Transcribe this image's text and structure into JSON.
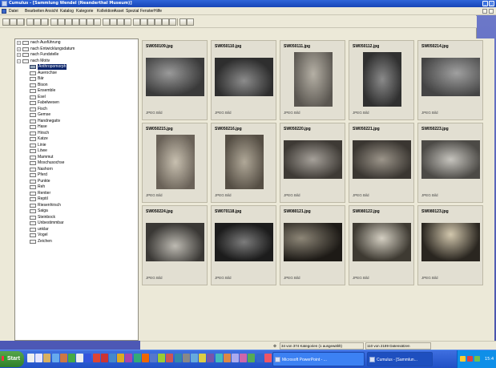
{
  "window": {
    "title": "Cumulus - [Sammlung Wendel (Neanderthal Museum)]"
  },
  "menu": [
    "Datei",
    "Bearbeiten",
    "Ansicht",
    "Katalog",
    "Kategorie",
    "Kollektion",
    "Asset",
    "Spezial",
    "Fenster",
    "Hilfe"
  ],
  "tree": {
    "roots": [
      {
        "label": "nach Ausführung",
        "expander": "+"
      },
      {
        "label": "nach Entwicklungsdatum",
        "expander": "+"
      },
      {
        "label": "nach Fundstelle",
        "expander": "+"
      },
      {
        "label": "nach Motiv",
        "expander": "−"
      }
    ],
    "children": [
      "Anthropomorph",
      "Auerochse",
      "Bär",
      "Bison",
      "Ensemble",
      "Esel",
      "Fabelwesen",
      "Fisch",
      "Gemse",
      "Handnegativ",
      "Hase",
      "Hirsch",
      "Katze",
      "Linie",
      "Löwe",
      "Mammut",
      "Moschusochse",
      "Nashorn",
      "Pferd",
      "Punkte",
      "Reh",
      "Rentier",
      "Reptil",
      "Riesenhirsch",
      "Saiga",
      "Steinbock",
      "Unbestimmbar",
      "unklar",
      "Vogel",
      "Zeichen"
    ],
    "selected": "Anthropomorph"
  },
  "thumbnails": [
    {
      "filename": "SW050109.jpg",
      "type": "JPEG Bild"
    },
    {
      "filename": "SW050110.jpg",
      "type": "JPEG Bild"
    },
    {
      "filename": "SW050111.jpg",
      "type": "JPEG Bild"
    },
    {
      "filename": "SW050112.jpg",
      "type": "JPEG Bild"
    },
    {
      "filename": "SW050214.jpg",
      "type": "JPEG Bild"
    },
    {
      "filename": "SW050215.jpg",
      "type": "JPEG Bild"
    },
    {
      "filename": "SW050216.jpg",
      "type": "JPEG Bild"
    },
    {
      "filename": "SW050220.jpg",
      "type": "JPEG Bild"
    },
    {
      "filename": "SW050221.jpg",
      "type": "JPEG Bild"
    },
    {
      "filename": "SW050223.jpg",
      "type": "JPEG Bild"
    },
    {
      "filename": "SW050224.jpg",
      "type": "JPEG Bild"
    },
    {
      "filename": "SW070118.jpg",
      "type": "JPEG Bild"
    },
    {
      "filename": "SW080121.jpg",
      "type": "JPEG Bild"
    },
    {
      "filename": "SW080122.jpg",
      "type": "JPEG Bild"
    },
    {
      "filename": "SW080123.jpg",
      "type": "JPEG Bild"
    }
  ],
  "status": {
    "categories": "34 von 374 Kategorien (1 ausgewählt)",
    "records": "110 von 2189 Datensätzen"
  },
  "taskbar": {
    "start_label": "Start",
    "tasks": [
      "Microsoft PowerPoint - ...",
      "Cumulus - [Sammlun..."
    ],
    "clock": "15:4"
  },
  "colors": {
    "titlebar": "#1f50c8",
    "desktop": "#4d58b5",
    "selection": "#0a246a",
    "taskbar": "#2a5fd4"
  }
}
